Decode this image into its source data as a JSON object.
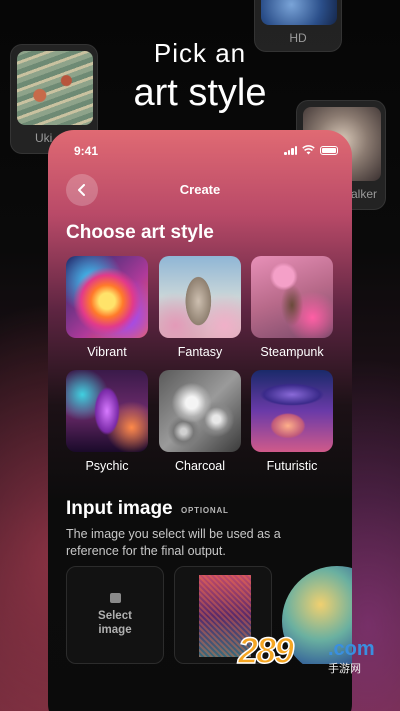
{
  "background_cards": {
    "hd_label": "HD",
    "ukiyo_label": "Uki",
    "walker_label": "alker"
  },
  "headline": {
    "line1": "Pick an",
    "line2": "art style"
  },
  "phone": {
    "status_time": "9:41",
    "nav_title": "Create",
    "section_title": "Choose art style",
    "styles": [
      {
        "name": "Vibrant"
      },
      {
        "name": "Fantasy"
      },
      {
        "name": "Steampunk"
      },
      {
        "name": "Psychic"
      },
      {
        "name": "Charcoal"
      },
      {
        "name": "Futuristic"
      }
    ],
    "input": {
      "title": "Input image",
      "badge": "OPTIONAL",
      "description": "The image you select will be used as a reference for the final output.",
      "select_label_1": "Select",
      "select_label_2": "image"
    }
  },
  "watermark": {
    "number": "289",
    "domain": ".com",
    "cn": "手游网"
  },
  "colors": {
    "accent_pink": "#e06a73",
    "watermark_orange": "#f5a623",
    "watermark_blue": "#3a8fe0"
  }
}
